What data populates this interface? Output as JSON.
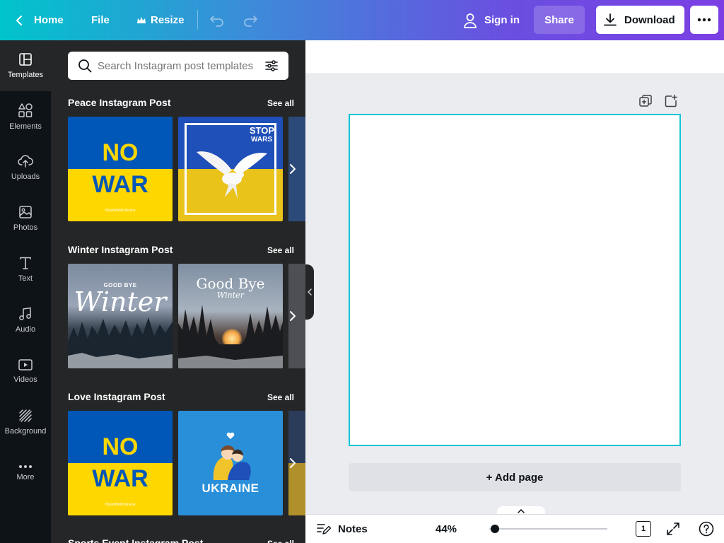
{
  "topbar": {
    "home_label": "Home",
    "file_label": "File",
    "resize_label": "Resize",
    "signin_label": "Sign in",
    "share_label": "Share",
    "download_label": "Download"
  },
  "rail": {
    "items": [
      {
        "label": "Templates",
        "icon": "templates-icon"
      },
      {
        "label": "Elements",
        "icon": "elements-icon"
      },
      {
        "label": "Uploads",
        "icon": "uploads-icon"
      },
      {
        "label": "Photos",
        "icon": "photos-icon"
      },
      {
        "label": "Text",
        "icon": "text-icon"
      },
      {
        "label": "Audio",
        "icon": "audio-icon"
      },
      {
        "label": "Videos",
        "icon": "videos-icon"
      },
      {
        "label": "Background",
        "icon": "background-icon"
      },
      {
        "label": "More",
        "icon": "more-icon"
      }
    ]
  },
  "panel": {
    "search_placeholder": "Search Instagram post templates",
    "see_all": "See all",
    "sections": [
      {
        "title": "Peace Instagram Post"
      },
      {
        "title": "Winter Instagram Post"
      },
      {
        "title": "Love Instagram Post"
      },
      {
        "title": "Sports Event Instagram Post"
      }
    ],
    "thumbs": {
      "no": "NO",
      "war": "WAR",
      "hashtag": "#StandWithUkraine",
      "stop": "STOP",
      "wars": "WARS",
      "goodbye_small": "GOOD BYE",
      "winter_script": "Winter",
      "goodbye_serif": "Good Bye",
      "winter_italic": "Winter",
      "ukraine": "UKRAINE"
    }
  },
  "canvas": {
    "add_page_label": "+ Add page"
  },
  "footer": {
    "notes_label": "Notes",
    "zoom_label": "44%",
    "zoom_value": 0.05,
    "page_count": "1"
  },
  "colors": {
    "accent": "#13c4d6",
    "ukraine_blue": "#0057b7",
    "ukraine_yellow": "#ffd700"
  }
}
